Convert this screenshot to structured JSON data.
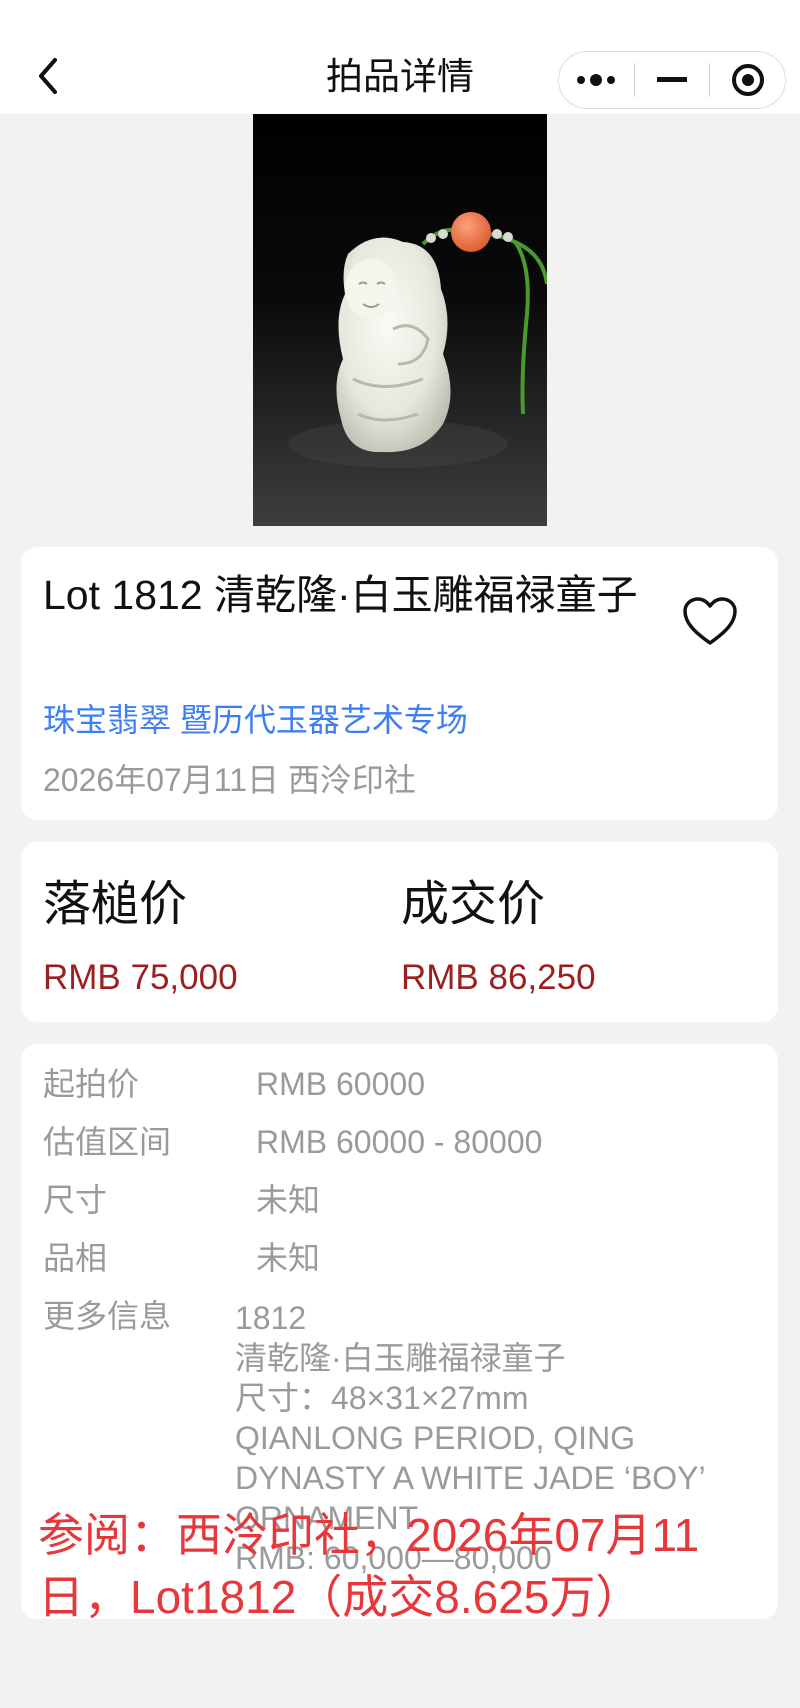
{
  "nav": {
    "title": "拍品详情"
  },
  "colors": {
    "accent_blue": "#3d7ef5",
    "price_red": "#9b1f1f",
    "watermark_red": "#e8373a"
  },
  "lot": {
    "title": "Lot 1812 清乾隆·白玉雕福禄童子",
    "session": "珠宝翡翠 暨历代玉器艺术专场",
    "date_house": "2026年07月11日 西泠印社"
  },
  "prices": {
    "hammer_label": "落槌价",
    "hammer_value": "RMB 75,000",
    "final_label": "成交价",
    "final_value": "RMB 86,250"
  },
  "details": [
    {
      "key": "起拍价",
      "value": "RMB 60000"
    },
    {
      "key": "估值区间",
      "value": "RMB 60000 - 80000"
    },
    {
      "key": "尺寸",
      "value": "未知"
    },
    {
      "key": "品相",
      "value": "未知"
    }
  ],
  "more_info": {
    "key": "更多信息",
    "lines": [
      "1812",
      "清乾隆·白玉雕福禄童子",
      "尺寸：48×31×27mm",
      "QIANLONG PERIOD, QING",
      "DYNASTY A WHITE JADE ‘BOY’",
      "ORNAMENT",
      "RMB: 60,000—80,000"
    ]
  },
  "watermark": {
    "line1": "参阅：西泠印社，2026年07月11",
    "line2": "日，Lot1812（成交8.625万）"
  }
}
